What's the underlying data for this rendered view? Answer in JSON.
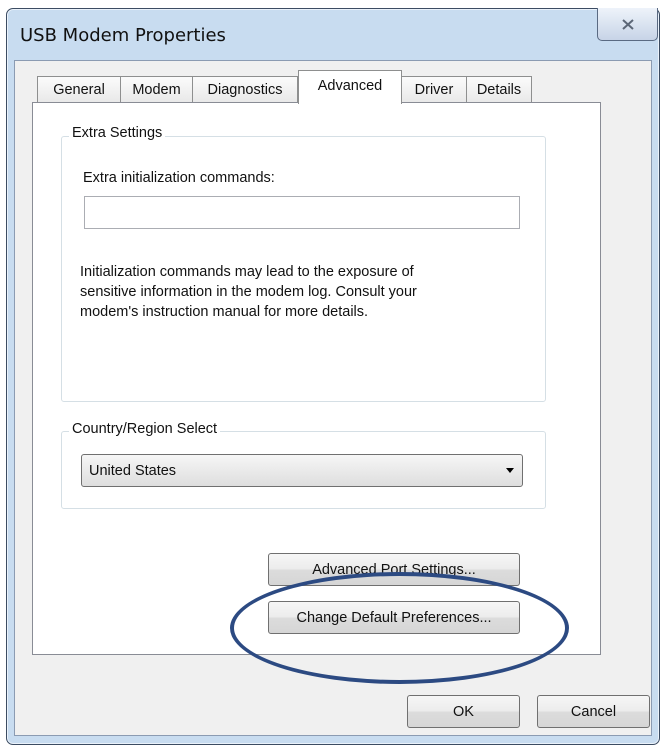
{
  "window": {
    "title": "USB Modem Properties",
    "close_icon": "close-icon"
  },
  "tabs": [
    {
      "label": "General",
      "active": false
    },
    {
      "label": "Modem",
      "active": false
    },
    {
      "label": "Diagnostics",
      "active": false
    },
    {
      "label": "Advanced",
      "active": true
    },
    {
      "label": "Driver",
      "active": false
    },
    {
      "label": "Details",
      "active": false
    }
  ],
  "extra_settings": {
    "group_label": "Extra Settings",
    "field_label": "Extra initialization commands:",
    "field_value": "",
    "note_lines": [
      "Initialization commands may lead to the exposure of",
      "sensitive information in the modem log. Consult your",
      "modem's instruction manual for more details."
    ]
  },
  "country": {
    "group_label": "Country/Region Select",
    "selected": "United States"
  },
  "buttons": {
    "advanced_port": "Advanced Port Settings...",
    "change_defaults": "Change Default Preferences...",
    "ok": "OK",
    "cancel": "Cancel"
  },
  "colors": {
    "frame": "#c8dcf0",
    "highlight_oval": "#2c4a82"
  }
}
